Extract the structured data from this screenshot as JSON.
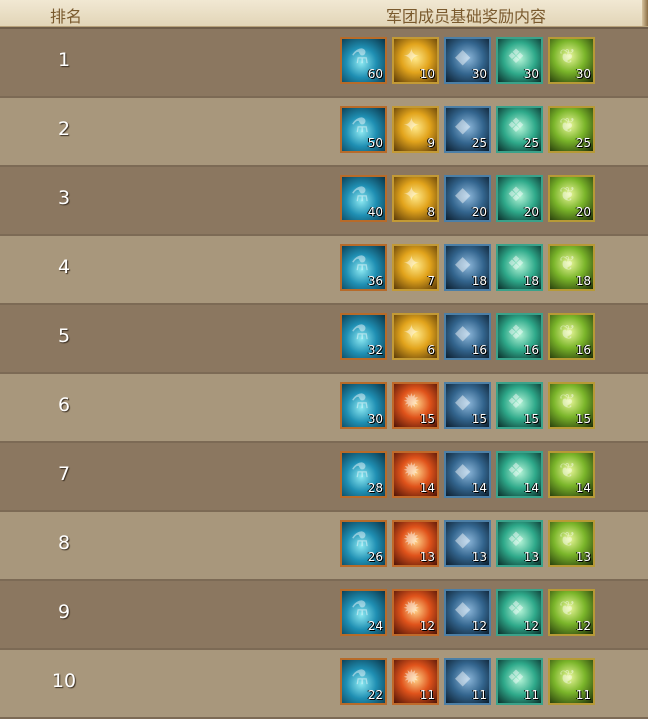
{
  "header": {
    "rank_label": "排名",
    "reward_label": "军团成员基础奖励内容"
  },
  "item_types": [
    "potion",
    "gold",
    "stone",
    "crystal",
    "herb"
  ],
  "rows": [
    {
      "rank": "1",
      "style": "dark",
      "rewards": [
        {
          "type": "potion",
          "qty": "60"
        },
        {
          "type": "gold",
          "qty": "10"
        },
        {
          "type": "stone",
          "qty": "30"
        },
        {
          "type": "crystal",
          "qty": "30"
        },
        {
          "type": "herb",
          "qty": "30"
        }
      ]
    },
    {
      "rank": "2",
      "style": "light",
      "rewards": [
        {
          "type": "potion",
          "qty": "50"
        },
        {
          "type": "gold",
          "qty": "9"
        },
        {
          "type": "stone",
          "qty": "25"
        },
        {
          "type": "crystal",
          "qty": "25"
        },
        {
          "type": "herb",
          "qty": "25"
        }
      ]
    },
    {
      "rank": "3",
      "style": "dark",
      "rewards": [
        {
          "type": "potion",
          "qty": "40"
        },
        {
          "type": "gold",
          "qty": "8"
        },
        {
          "type": "stone",
          "qty": "20"
        },
        {
          "type": "crystal",
          "qty": "20"
        },
        {
          "type": "herb",
          "qty": "20"
        }
      ]
    },
    {
      "rank": "4",
      "style": "light",
      "rewards": [
        {
          "type": "potion",
          "qty": "36"
        },
        {
          "type": "gold",
          "qty": "7"
        },
        {
          "type": "stone",
          "qty": "18"
        },
        {
          "type": "crystal",
          "qty": "18"
        },
        {
          "type": "herb",
          "qty": "18"
        }
      ]
    },
    {
      "rank": "5",
      "style": "dark",
      "rewards": [
        {
          "type": "potion",
          "qty": "32"
        },
        {
          "type": "gold",
          "qty": "6"
        },
        {
          "type": "stone",
          "qty": "16"
        },
        {
          "type": "crystal",
          "qty": "16"
        },
        {
          "type": "herb",
          "qty": "16"
        }
      ]
    },
    {
      "rank": "6",
      "style": "light",
      "rewards": [
        {
          "type": "potion",
          "qty": "30"
        },
        {
          "type": "fire",
          "qty": "15"
        },
        {
          "type": "stone",
          "qty": "15"
        },
        {
          "type": "crystal",
          "qty": "15"
        },
        {
          "type": "herb",
          "qty": "15"
        }
      ]
    },
    {
      "rank": "7",
      "style": "dark",
      "rewards": [
        {
          "type": "potion",
          "qty": "28"
        },
        {
          "type": "fire",
          "qty": "14"
        },
        {
          "type": "stone",
          "qty": "14"
        },
        {
          "type": "crystal",
          "qty": "14"
        },
        {
          "type": "herb",
          "qty": "14"
        }
      ]
    },
    {
      "rank": "8",
      "style": "light",
      "rewards": [
        {
          "type": "potion",
          "qty": "26"
        },
        {
          "type": "fire",
          "qty": "13"
        },
        {
          "type": "stone",
          "qty": "13"
        },
        {
          "type": "crystal",
          "qty": "13"
        },
        {
          "type": "herb",
          "qty": "13"
        }
      ]
    },
    {
      "rank": "9",
      "style": "dark",
      "rewards": [
        {
          "type": "potion",
          "qty": "24"
        },
        {
          "type": "fire",
          "qty": "12"
        },
        {
          "type": "stone",
          "qty": "12"
        },
        {
          "type": "crystal",
          "qty": "12"
        },
        {
          "type": "herb",
          "qty": "12"
        }
      ]
    },
    {
      "rank": "10",
      "style": "light",
      "rewards": [
        {
          "type": "potion",
          "qty": "22"
        },
        {
          "type": "fire",
          "qty": "11"
        },
        {
          "type": "stone",
          "qty": "11"
        },
        {
          "type": "crystal",
          "qty": "11"
        },
        {
          "type": "herb",
          "qty": "11"
        }
      ]
    }
  ]
}
